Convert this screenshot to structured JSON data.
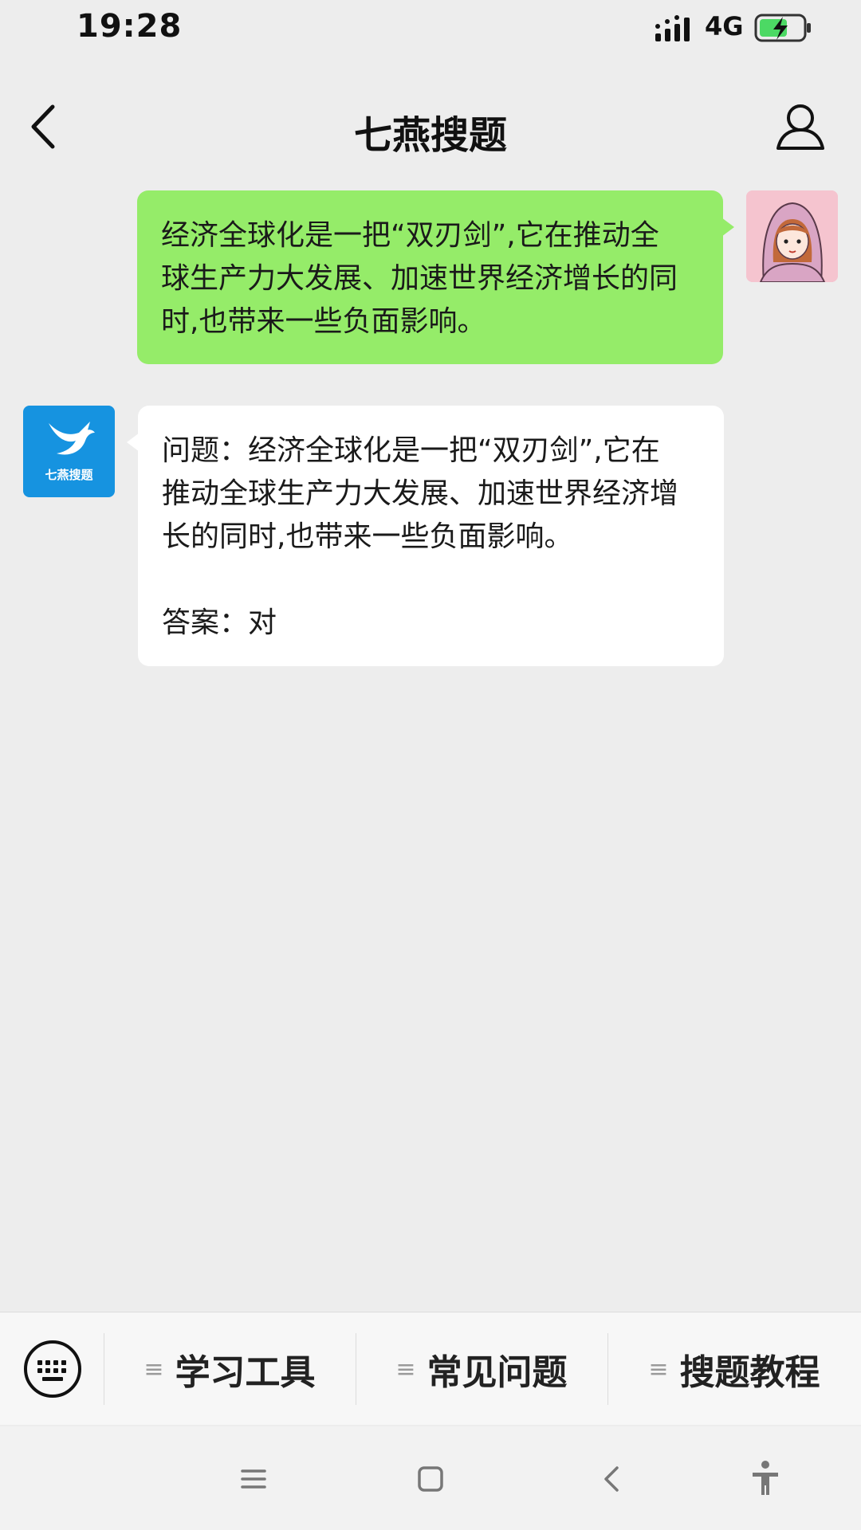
{
  "status_bar": {
    "time": "19:28",
    "network": "4G",
    "battery_color": "#4cd964"
  },
  "nav": {
    "title": "七燕搜题",
    "back_icon": "chevron-left-icon",
    "profile_icon": "person-icon"
  },
  "messages": {
    "outgoing": {
      "lines": [
        "经济全球化是一把“双刃剑”,它在推动全",
        "球生产力大发展、加速世界经济增长的同",
        "时,也带来一些负面影响。"
      ],
      "bubble_color": "#95ec69"
    },
    "incoming": {
      "sender_logo_text": "七燕搜题",
      "question_lines": [
        "问题：经济全球化是一把“双刃剑”,它在",
        "推动全球生产力大发展、加速世界经济增",
        "长的同时,也带来一些负面影响。"
      ],
      "answer": "答案：对",
      "logo_color": "#1693e0"
    }
  },
  "menu": {
    "keyboard_icon": "keyboard-icon",
    "items": [
      {
        "label": "学习工具"
      },
      {
        "label": "常见问题"
      },
      {
        "label": "搜题教程"
      }
    ]
  },
  "system_nav": {
    "icons": [
      "menu-icon",
      "home-icon",
      "back-icon",
      "accessibility-icon"
    ]
  }
}
